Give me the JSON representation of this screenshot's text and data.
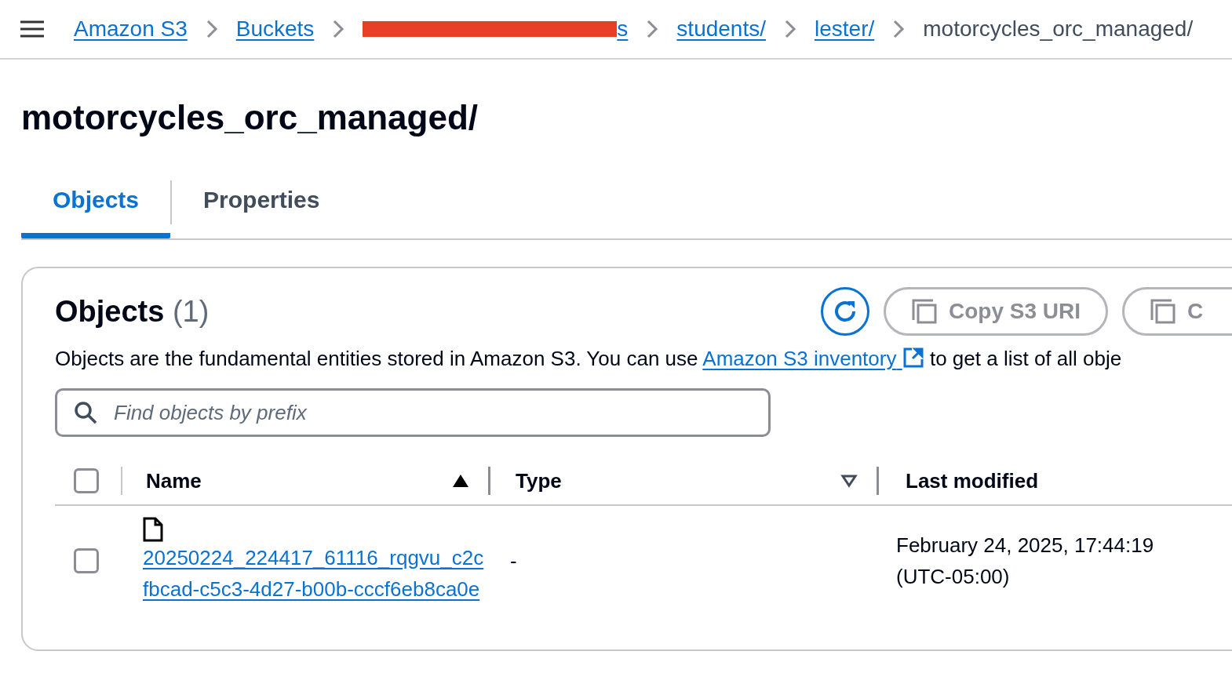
{
  "breadcrumbs": [
    {
      "label": "Amazon S3",
      "kind": "link"
    },
    {
      "label": "Buckets",
      "kind": "link"
    },
    {
      "label": "s",
      "kind": "redacted-link"
    },
    {
      "label": "students/",
      "kind": "link"
    },
    {
      "label": "lester/",
      "kind": "link"
    },
    {
      "label": "motorcycles_orc_managed/",
      "kind": "current"
    }
  ],
  "title": "motorcycles_orc_managed/",
  "tabs": [
    {
      "label": "Objects",
      "selected": true
    },
    {
      "label": "Properties",
      "selected": false
    }
  ],
  "panel": {
    "title": "Objects",
    "count": "(1)",
    "buttons": [
      {
        "label": "Copy S3 URI",
        "disabled": true
      },
      {
        "label": "C",
        "disabled": true
      }
    ],
    "description": {
      "before": "Objects are the fundamental entities stored in Amazon S3. You can use ",
      "link": "Amazon S3 inventory",
      "after": "to get a list of all obje"
    },
    "search": {
      "placeholder": "Find objects by prefix"
    },
    "select_all_checked": false,
    "columns": [
      {
        "label": "Name",
        "sort_active": true
      },
      {
        "label": "Type",
        "sort_active": false
      },
      {
        "label": "Last modified"
      }
    ],
    "rows": [
      {
        "checked": false,
        "name": "20250224_224417_61116_rqgvu_c2cfbcad-c5c3-4d27-b00b-cccf6eb8ca0e",
        "type": "-",
        "modified": "February 24, 2025, 17:44:19 (UTC-05:00)"
      }
    ]
  }
}
